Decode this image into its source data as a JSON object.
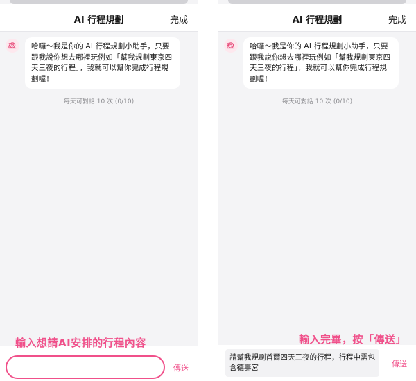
{
  "screens": [
    {
      "header": {
        "title": "AI 行程規劃",
        "done_label": "完成"
      },
      "chat": {
        "bot_message": "哈囉～我是你的 AI 行程規劃小助手，只要跟我說你想去哪裡玩例如「幫我規劃東京四天三夜的行程」，我就可以幫你完成行程規劃喔！",
        "quota_text": "每天可對話 10 次 (0/10)"
      },
      "annotation": "輸入想請AI安排的行程內容",
      "input": {
        "value": "",
        "send_label": "傳送"
      }
    },
    {
      "header": {
        "title": "AI 行程規劃",
        "done_label": "完成"
      },
      "chat": {
        "bot_message": "哈囉～我是你的 AI 行程規劃小助手，只要跟我說你想去哪裡玩例如「幫我規劃東京四天三夜的行程」，我就可以幫你完成行程規劃喔！",
        "quota_text": "每天可對話 10 次 (0/10)"
      },
      "annotation": "輸入完畢，按「傳送」",
      "input": {
        "value": "請幫我規劃首爾四天三夜的行程，行程中需包含德壽宮",
        "send_label": "傳送"
      }
    }
  ],
  "icons": {
    "bot_avatar": "snail-icon"
  },
  "colors": {
    "accent": "#f0508a",
    "chat_background": "#f4f4f6",
    "bubble": "#ffffff",
    "muted_text": "#8c8c90"
  }
}
